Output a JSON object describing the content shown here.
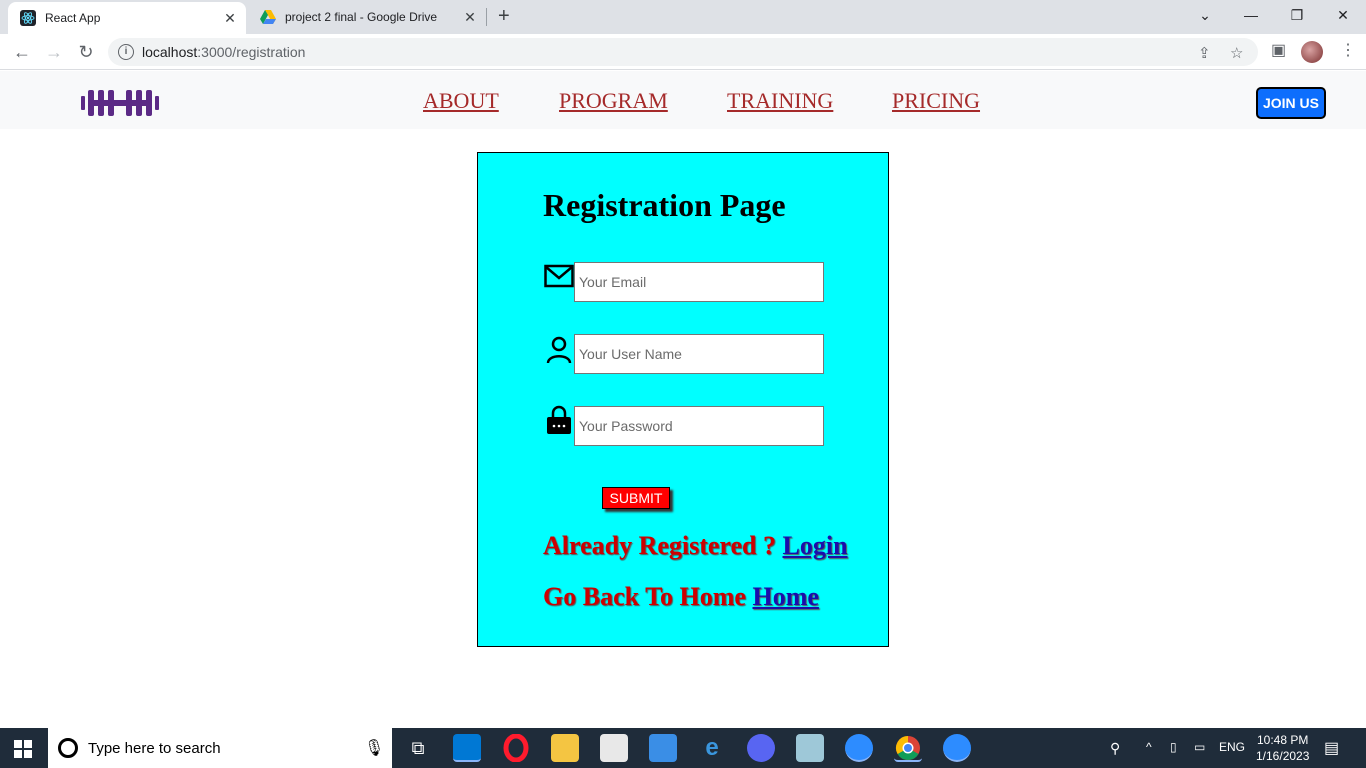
{
  "browser": {
    "tabs": [
      {
        "title": "React App",
        "icon": "react-icon"
      },
      {
        "title": "project 2 final - Google Drive",
        "icon": "google-drive-icon"
      }
    ],
    "url_host": "localhost",
    "url_path": ":3000/registration"
  },
  "nav": {
    "links": [
      "ABOUT",
      "PROGRAM",
      "TRAINING",
      "PRICING"
    ],
    "join_label": "JOIN US"
  },
  "registration": {
    "title": "Registration Page",
    "email_placeholder": "Your Email",
    "username_placeholder": "Your User Name",
    "password_placeholder": "Your Password",
    "submit_label": "SUBMIT",
    "already_text": "Already Registered ? ",
    "login_link": "Login",
    "back_text": "Go Back To Home ",
    "home_link": "Home"
  },
  "taskbar": {
    "search_placeholder": "Type here to search",
    "lang": "ENG",
    "time": "10:48 PM",
    "date": "1/16/2023"
  },
  "colors": {
    "card_bg": "#00ffff",
    "link_red": "#a52a2a",
    "join_blue": "#0d6efd",
    "submit_red": "#ff0000",
    "logo_purple": "#5b2a86"
  }
}
